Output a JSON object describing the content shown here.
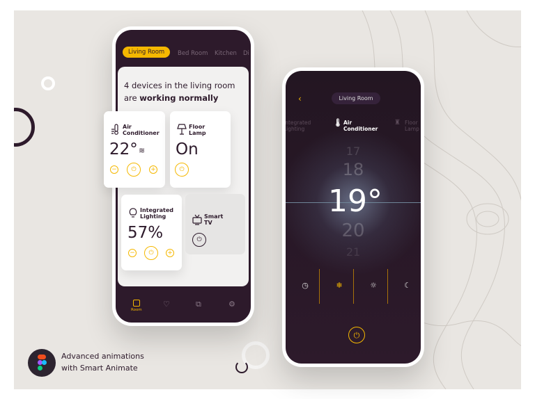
{
  "colors": {
    "accent": "#f5b800",
    "dark": "#2d1a2b",
    "background": "#e9e6e2"
  },
  "left_phone": {
    "tabs": [
      {
        "label": "Living Room",
        "active": true
      },
      {
        "label": "Bed Room"
      },
      {
        "label": "Kitchen"
      },
      {
        "label": "Di"
      }
    ],
    "summary_prefix": "4 devices in the living room",
    "summary_are": "are ",
    "summary_bold": "working normally",
    "devices": [
      {
        "name_line1": "Air",
        "name_line2": "Conditioner",
        "value": "22°",
        "icon": "thermometer-icon"
      },
      {
        "name_line1": "Floor",
        "name_line2": "Lamp",
        "value": "On",
        "icon": "floor-lamp-icon"
      },
      {
        "name_line1": "Integrated",
        "name_line2": "Lighting",
        "value": "57%",
        "icon": "lightbulb-icon"
      },
      {
        "name_line1": "Smart",
        "name_line2": "TV",
        "icon": "tv-icon"
      }
    ],
    "nav": [
      {
        "label": "Room",
        "icon": "room-icon",
        "active": true
      },
      {
        "icon": "heart-icon"
      },
      {
        "icon": "scenes-icon"
      },
      {
        "icon": "gear-icon"
      }
    ]
  },
  "right_phone": {
    "title": "Living Room",
    "device_tabs": [
      {
        "line1": "Integrated",
        "line2": "Lighting"
      },
      {
        "line1": "Air",
        "line2": "Conditioner",
        "active": true
      },
      {
        "line1": "Floor",
        "line2": "Lamp"
      }
    ],
    "temps": [
      "17",
      "18",
      "19°",
      "20",
      "21"
    ],
    "selected_temp": "19°",
    "modes": [
      {
        "icon": "clock-icon"
      },
      {
        "icon": "snowflake-icon",
        "active": true
      },
      {
        "icon": "sun-icon"
      },
      {
        "icon": "moon-icon"
      }
    ]
  },
  "caption": {
    "line1": "Advanced animations",
    "line2": "with Smart Animate"
  }
}
